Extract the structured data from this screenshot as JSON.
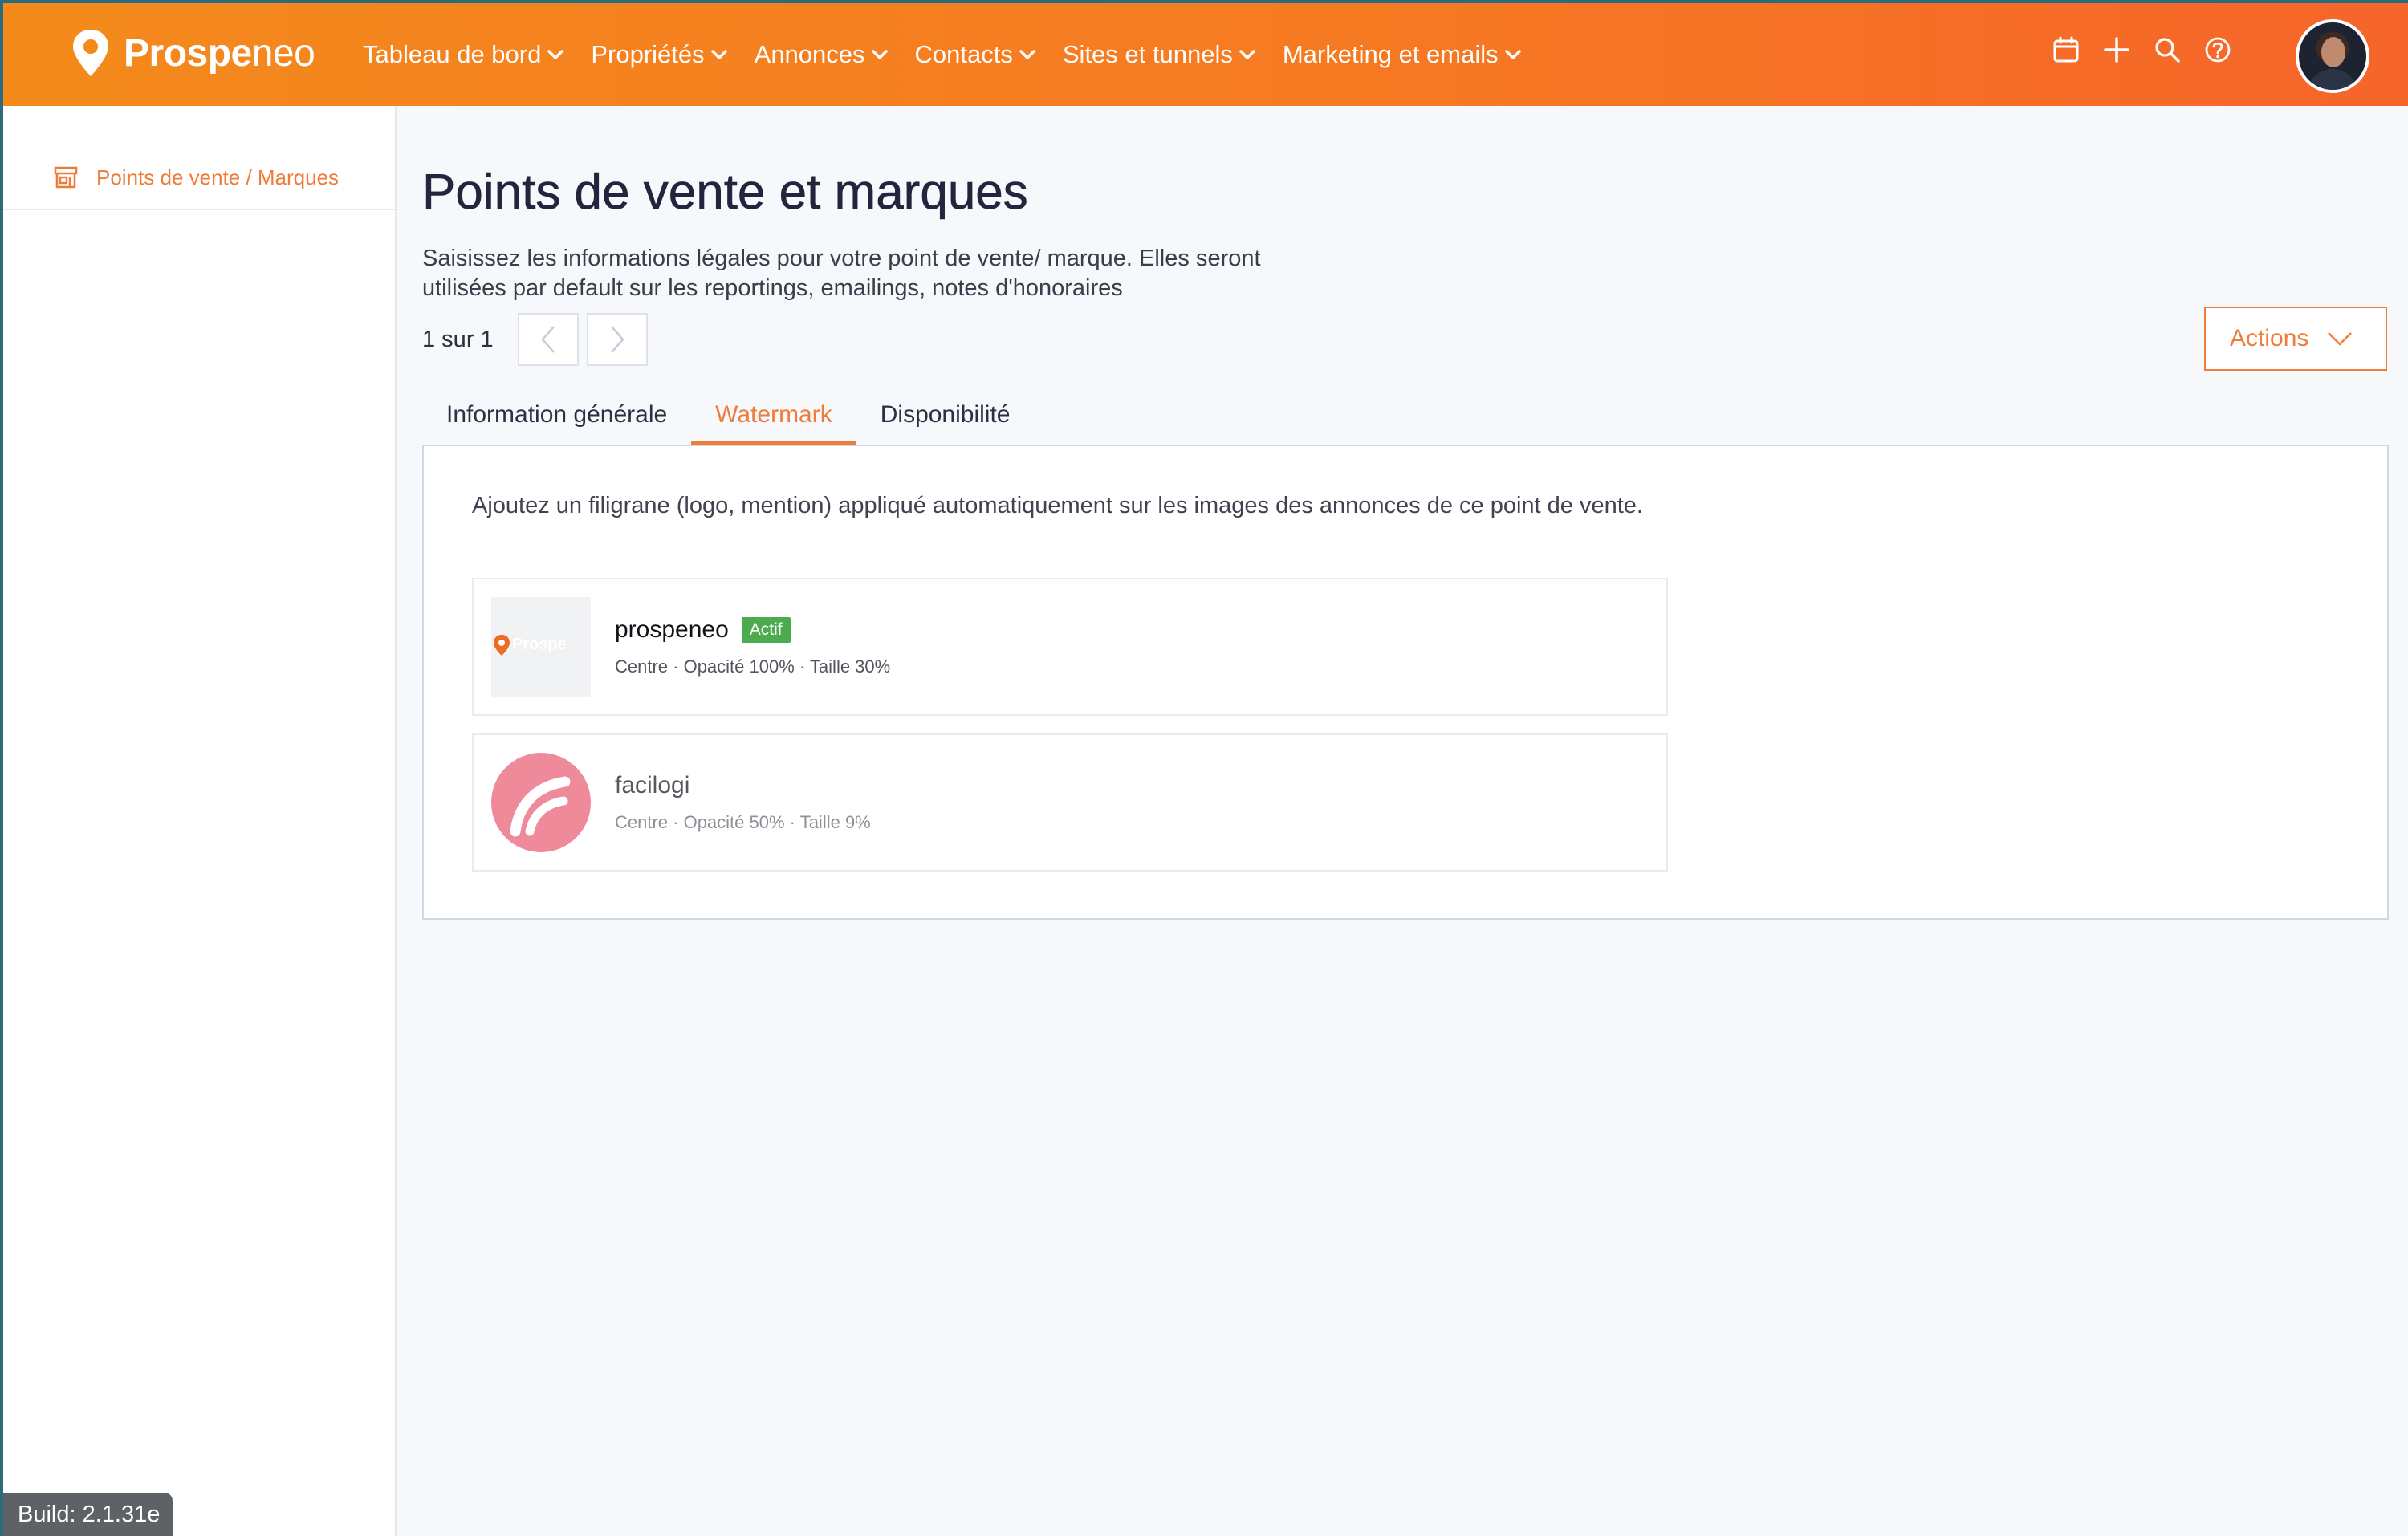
{
  "brand": {
    "name_bold": "Prospe",
    "name_light": "neo"
  },
  "nav": [
    {
      "label": "Tableau de bord"
    },
    {
      "label": "Propriétés"
    },
    {
      "label": "Annonces"
    },
    {
      "label": "Contacts"
    },
    {
      "label": "Sites et tunnels"
    },
    {
      "label": "Marketing et emails"
    }
  ],
  "tools": [
    "calendar-icon",
    "plus-icon",
    "search-icon",
    "help-icon"
  ],
  "sidebar": {
    "items": [
      {
        "label": "Points de vente / Marques",
        "icon": "store-icon"
      }
    ]
  },
  "build": "Build: 2.1.31e",
  "page": {
    "title": "Points de vente et marques",
    "description": "Saisissez les informations légales pour votre point de vente/ marque. Elles seront utilisées par default sur les reportings, emailings, notes d'honoraires",
    "pager": "1 sur 1",
    "actions_label": "Actions"
  },
  "tabs": [
    {
      "label": "Information générale",
      "active": false
    },
    {
      "label": "Watermark",
      "active": true
    },
    {
      "label": "Disponibilité",
      "active": false
    }
  ],
  "watermark": {
    "description": "Ajoutez un filigrane (logo, mention) appliqué automatiquement sur les images des annonces de ce point de vente.",
    "items": [
      {
        "name": "prospeneo",
        "badge": "Actif",
        "meta": "Centre · Opacité 100% · Taille 30%"
      },
      {
        "name": "facilogi",
        "badge": "",
        "meta": "Centre · Opacité 50% · Taille 9%"
      }
    ]
  },
  "colors": {
    "accent": "#ee7d3a",
    "topbar_start": "#f48a1c",
    "topbar_end": "#f6652a",
    "badge": "#4caa4f"
  }
}
